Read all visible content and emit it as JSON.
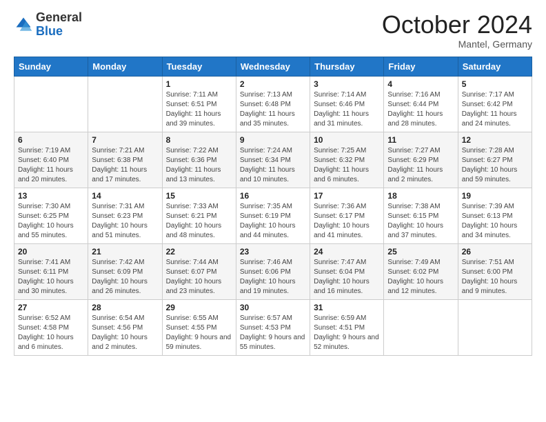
{
  "logo": {
    "general": "General",
    "blue": "Blue"
  },
  "header": {
    "month": "October 2024",
    "location": "Mantel, Germany"
  },
  "weekdays": [
    "Sunday",
    "Monday",
    "Tuesday",
    "Wednesday",
    "Thursday",
    "Friday",
    "Saturday"
  ],
  "weeks": [
    [
      {
        "day": "",
        "info": ""
      },
      {
        "day": "",
        "info": ""
      },
      {
        "day": "1",
        "info": "Sunrise: 7:11 AM\nSunset: 6:51 PM\nDaylight: 11 hours and 39 minutes."
      },
      {
        "day": "2",
        "info": "Sunrise: 7:13 AM\nSunset: 6:48 PM\nDaylight: 11 hours and 35 minutes."
      },
      {
        "day": "3",
        "info": "Sunrise: 7:14 AM\nSunset: 6:46 PM\nDaylight: 11 hours and 31 minutes."
      },
      {
        "day": "4",
        "info": "Sunrise: 7:16 AM\nSunset: 6:44 PM\nDaylight: 11 hours and 28 minutes."
      },
      {
        "day": "5",
        "info": "Sunrise: 7:17 AM\nSunset: 6:42 PM\nDaylight: 11 hours and 24 minutes."
      }
    ],
    [
      {
        "day": "6",
        "info": "Sunrise: 7:19 AM\nSunset: 6:40 PM\nDaylight: 11 hours and 20 minutes."
      },
      {
        "day": "7",
        "info": "Sunrise: 7:21 AM\nSunset: 6:38 PM\nDaylight: 11 hours and 17 minutes."
      },
      {
        "day": "8",
        "info": "Sunrise: 7:22 AM\nSunset: 6:36 PM\nDaylight: 11 hours and 13 minutes."
      },
      {
        "day": "9",
        "info": "Sunrise: 7:24 AM\nSunset: 6:34 PM\nDaylight: 11 hours and 10 minutes."
      },
      {
        "day": "10",
        "info": "Sunrise: 7:25 AM\nSunset: 6:32 PM\nDaylight: 11 hours and 6 minutes."
      },
      {
        "day": "11",
        "info": "Sunrise: 7:27 AM\nSunset: 6:29 PM\nDaylight: 11 hours and 2 minutes."
      },
      {
        "day": "12",
        "info": "Sunrise: 7:28 AM\nSunset: 6:27 PM\nDaylight: 10 hours and 59 minutes."
      }
    ],
    [
      {
        "day": "13",
        "info": "Sunrise: 7:30 AM\nSunset: 6:25 PM\nDaylight: 10 hours and 55 minutes."
      },
      {
        "day": "14",
        "info": "Sunrise: 7:31 AM\nSunset: 6:23 PM\nDaylight: 10 hours and 51 minutes."
      },
      {
        "day": "15",
        "info": "Sunrise: 7:33 AM\nSunset: 6:21 PM\nDaylight: 10 hours and 48 minutes."
      },
      {
        "day": "16",
        "info": "Sunrise: 7:35 AM\nSunset: 6:19 PM\nDaylight: 10 hours and 44 minutes."
      },
      {
        "day": "17",
        "info": "Sunrise: 7:36 AM\nSunset: 6:17 PM\nDaylight: 10 hours and 41 minutes."
      },
      {
        "day": "18",
        "info": "Sunrise: 7:38 AM\nSunset: 6:15 PM\nDaylight: 10 hours and 37 minutes."
      },
      {
        "day": "19",
        "info": "Sunrise: 7:39 AM\nSunset: 6:13 PM\nDaylight: 10 hours and 34 minutes."
      }
    ],
    [
      {
        "day": "20",
        "info": "Sunrise: 7:41 AM\nSunset: 6:11 PM\nDaylight: 10 hours and 30 minutes."
      },
      {
        "day": "21",
        "info": "Sunrise: 7:42 AM\nSunset: 6:09 PM\nDaylight: 10 hours and 26 minutes."
      },
      {
        "day": "22",
        "info": "Sunrise: 7:44 AM\nSunset: 6:07 PM\nDaylight: 10 hours and 23 minutes."
      },
      {
        "day": "23",
        "info": "Sunrise: 7:46 AM\nSunset: 6:06 PM\nDaylight: 10 hours and 19 minutes."
      },
      {
        "day": "24",
        "info": "Sunrise: 7:47 AM\nSunset: 6:04 PM\nDaylight: 10 hours and 16 minutes."
      },
      {
        "day": "25",
        "info": "Sunrise: 7:49 AM\nSunset: 6:02 PM\nDaylight: 10 hours and 12 minutes."
      },
      {
        "day": "26",
        "info": "Sunrise: 7:51 AM\nSunset: 6:00 PM\nDaylight: 10 hours and 9 minutes."
      }
    ],
    [
      {
        "day": "27",
        "info": "Sunrise: 6:52 AM\nSunset: 4:58 PM\nDaylight: 10 hours and 6 minutes."
      },
      {
        "day": "28",
        "info": "Sunrise: 6:54 AM\nSunset: 4:56 PM\nDaylight: 10 hours and 2 minutes."
      },
      {
        "day": "29",
        "info": "Sunrise: 6:55 AM\nSunset: 4:55 PM\nDaylight: 9 hours and 59 minutes."
      },
      {
        "day": "30",
        "info": "Sunrise: 6:57 AM\nSunset: 4:53 PM\nDaylight: 9 hours and 55 minutes."
      },
      {
        "day": "31",
        "info": "Sunrise: 6:59 AM\nSunset: 4:51 PM\nDaylight: 9 hours and 52 minutes."
      },
      {
        "day": "",
        "info": ""
      },
      {
        "day": "",
        "info": ""
      }
    ]
  ]
}
